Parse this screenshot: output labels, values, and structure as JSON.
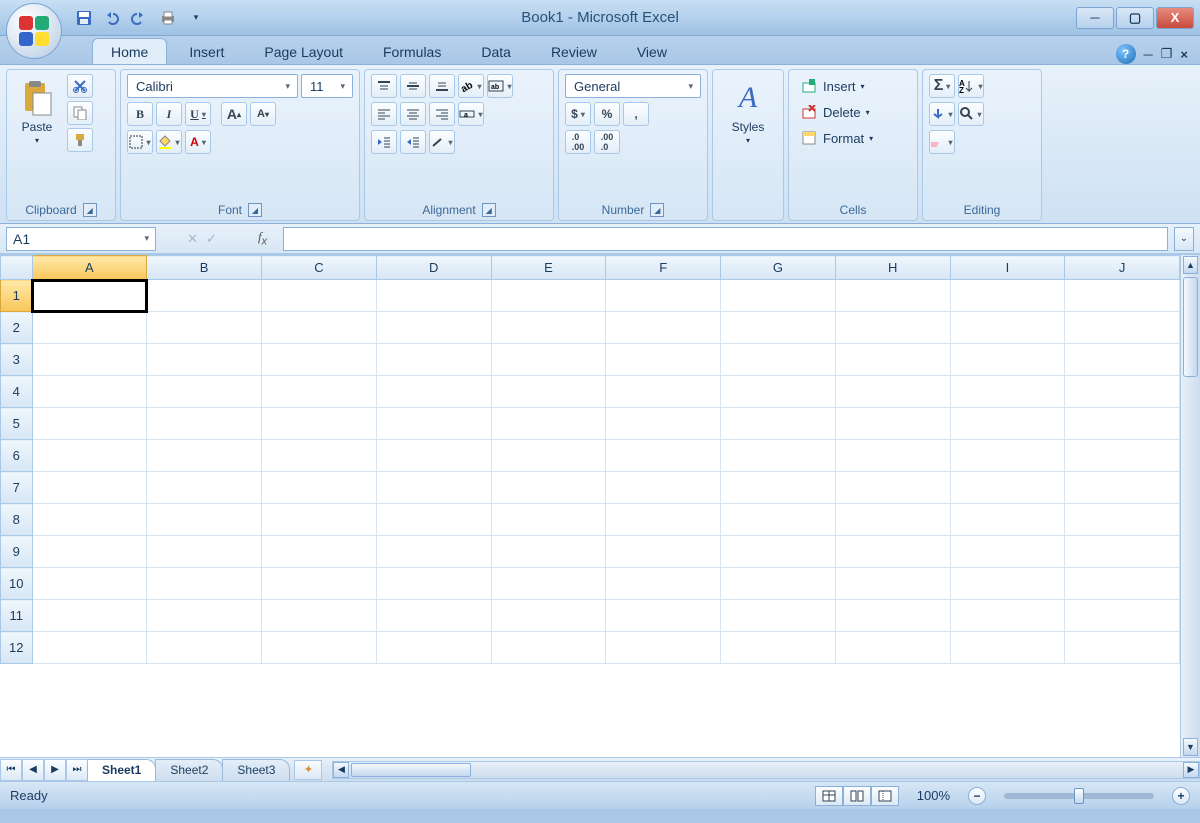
{
  "title": "Book1 - Microsoft Excel",
  "tabs": [
    "Home",
    "Insert",
    "Page Layout",
    "Formulas",
    "Data",
    "Review",
    "View"
  ],
  "active_tab": "Home",
  "ribbon": {
    "clipboard": {
      "label": "Clipboard",
      "paste": "Paste"
    },
    "font": {
      "label": "Font",
      "name": "Calibri",
      "size": "11"
    },
    "alignment": {
      "label": "Alignment"
    },
    "number": {
      "label": "Number",
      "format": "General"
    },
    "styles": {
      "label": "Styles"
    },
    "cells": {
      "label": "Cells",
      "insert": "Insert",
      "delete": "Delete",
      "format": "Format"
    },
    "editing": {
      "label": "Editing"
    }
  },
  "namebox": "A1",
  "columns": [
    "A",
    "B",
    "C",
    "D",
    "E",
    "F",
    "G",
    "H",
    "I",
    "J"
  ],
  "rows": [
    "1",
    "2",
    "3",
    "4",
    "5",
    "6",
    "7",
    "8",
    "9",
    "10",
    "11",
    "12"
  ],
  "active_cell": {
    "row": 0,
    "col": 0
  },
  "sheets": [
    "Sheet1",
    "Sheet2",
    "Sheet3"
  ],
  "active_sheet": "Sheet1",
  "status": "Ready",
  "zoom": "100%"
}
